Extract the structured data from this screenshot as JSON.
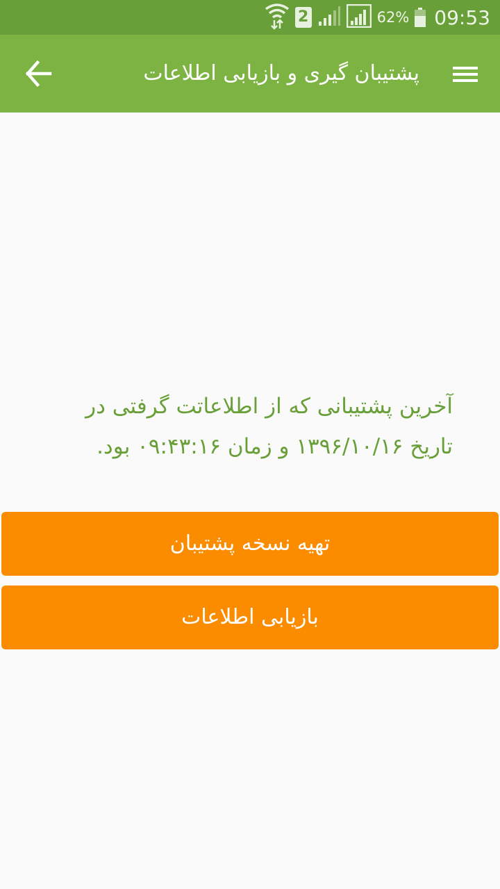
{
  "status_bar": {
    "battery_percent": "62%",
    "battery_level": 0.62,
    "sim_label": "2",
    "time": "09:53"
  },
  "app_bar": {
    "title": "پشتیبان گیری و بازیابی اطلاعات",
    "back_icon": "arrow-back-icon",
    "menu_icon": "hamburger-menu-icon"
  },
  "content": {
    "message": "آخرین پشتیبانی که از اطلاعاتت گرفتی در تاریخ ۱۳۹۶/۱۰/۱۶ و زمان ۰۹:۴۳:۱۶ بود."
  },
  "actions": {
    "backup_label": "تهیه نسخه پشتیبان",
    "restore_label": "بازیابی اطلاعات"
  },
  "colors": {
    "status_bar": "#689f38",
    "app_bar": "#7cb342",
    "message_text": "#689f38",
    "button": "#fb8c00",
    "background": "#fafafa"
  }
}
